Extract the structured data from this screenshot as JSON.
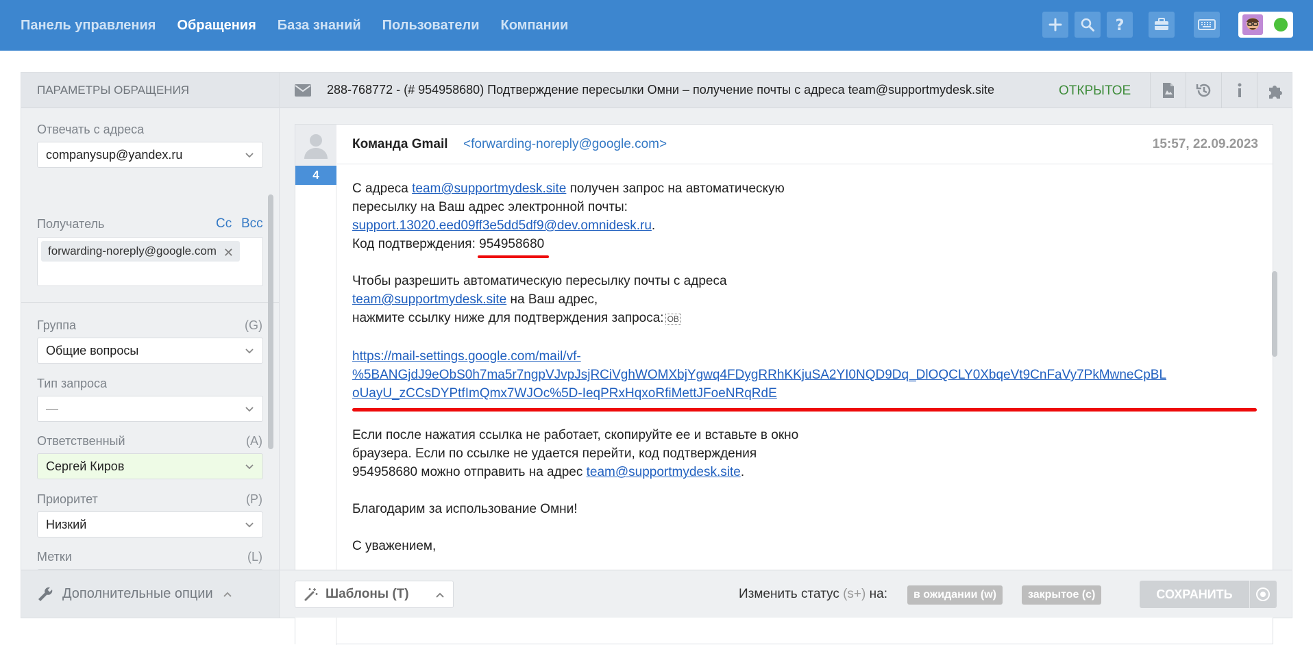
{
  "nav": {
    "items": [
      {
        "label": "Панель управления",
        "active": false
      },
      {
        "label": "Обращения",
        "active": true
      },
      {
        "label": "База знаний",
        "active": false
      },
      {
        "label": "Пользователи",
        "active": false
      },
      {
        "label": "Компании",
        "active": false
      }
    ],
    "toolbar_icons": [
      "plus-icon",
      "search-icon",
      "question-icon",
      "briefcase-icon",
      "keyboard-icon"
    ],
    "user_status_color": "#4cc13b"
  },
  "left_panel": {
    "title": "ПАРАМЕТРЫ ОБРАЩЕНИЯ",
    "reply_from": {
      "label": "Отвечать с адреса",
      "value": "companysup@yandex.ru"
    },
    "recipient": {
      "label": "Получатель",
      "cc": "Cc",
      "bcc": "Bcc",
      "chip": "forwarding-noreply@google.com"
    },
    "group": {
      "label": "Группа",
      "hint": "(G)",
      "value": "Общие вопросы"
    },
    "request_type": {
      "label": "Тип запроса",
      "value": "—"
    },
    "assignee": {
      "label": "Ответственный",
      "hint": "(A)",
      "value": "Сергей Киров"
    },
    "priority": {
      "label": "Приоритет",
      "hint": "(P)",
      "value": "Низкий"
    },
    "tags": {
      "label": "Метки",
      "hint": "(L)",
      "value": ""
    },
    "footer": "Дополнительные опции"
  },
  "ticket": {
    "title": "288-768772 - (# 954958680) Подтверждение пересылки Омни – получение почты с адреса team@supportmydesk.site",
    "status": "ОТКРЫТОЕ",
    "header_icons": [
      "pdf-icon",
      "history-icon",
      "info-icon",
      "puzzle-icon"
    ]
  },
  "message": {
    "number": "4",
    "sender_name": "Команда Gmail",
    "sender_email": "<forwarding-noreply@google.com>",
    "time": "15:57, 22.09.2023",
    "p1_a": "С адреса ",
    "p1_link1": "team@supportmydesk.site",
    "p1_b": " получен запрос на автоматическую",
    "p1_c": "пересылку на Ваш адрес электронной почты:",
    "p1_link2": "support.13020.eed09ff3e5dd5df9@dev.omnidesk.ru",
    "p1_d": ".",
    "p1_code_label": "Код подтверждения: ",
    "p1_code": "954958680",
    "p2_a": "Чтобы разрешить автоматическую пересылку почты с адреса",
    "p2_link": "team@supportmydesk.site",
    "p2_b": " на Ваш адрес,",
    "p2_c": "нажмите ссылку ниже для подтверждения запроса:",
    "link_line1": "https://mail-settings.google.com/mail/vf-",
    "link_line2": "%5BANGjdJ9eObS0h7ma5r7ngpVJvpJsjRCiVghWOMXbjYgwq4FDygRRhKKjuSA2YI0NQD9Dq_DlOQCLY0XbqeVt9CnFaVy7PkMwneCpBL",
    "link_line3": "oUayU_zCCsDYPtfImQmx7WJOc%5D-IeqPRxHqxoRfiMettJFoeNRqRdE",
    "p3_a": "Если после нажатия ссылка не работает, скопируйте ее и вставьте в окно",
    "p3_b": "браузера. Если по ссылке не удается перейти, код подтверждения",
    "p3_c": "954958680 можно отправить на адрес ",
    "p3_link": "team@supportmydesk.site",
    "p3_d": ".",
    "p4": "Благодарим за использование Омни!",
    "p5": "С уважением,"
  },
  "footer": {
    "templates": "Шаблоны (T)",
    "change_status_a": "Изменить статус ",
    "change_status_hint": "(s+)",
    "change_status_b": " на:",
    "status_pending": "в ожидании (w)",
    "status_closed": "закрытое (c)",
    "save": "СОХРАНИТЬ"
  }
}
